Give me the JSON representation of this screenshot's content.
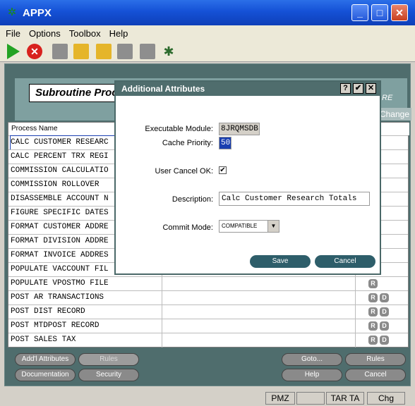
{
  "window": {
    "title": "APPX",
    "min": "_",
    "max": "□",
    "close": "✕"
  },
  "menu": [
    "File",
    "Options",
    "Toolbox",
    "Help"
  ],
  "header": {
    "subroutine_label": "Subroutine Proce",
    "logo_text": "RE",
    "change_tab": "Change"
  },
  "table": {
    "column_header": "Process Name",
    "rows": [
      {
        "name": "CALC CUSTOMER RESEARC",
        "badges": []
      },
      {
        "name": "CALC PERCENT TRX REGI",
        "badges": []
      },
      {
        "name": "COMMISSION CALCULATIO",
        "badges": []
      },
      {
        "name": "COMMISSION ROLLOVER",
        "badges": []
      },
      {
        "name": "DISASSEMBLE ACCOUNT N",
        "badges": []
      },
      {
        "name": "FIGURE SPECIFIC DATES",
        "badges": []
      },
      {
        "name": "FORMAT CUSTOMER ADDRE",
        "badges": []
      },
      {
        "name": "FORMAT DIVISION ADDRE",
        "badges": []
      },
      {
        "name": "FORMAT INVOICE ADDRES",
        "badges": []
      },
      {
        "name": "POPULATE VACCOUNT FIL",
        "badges": []
      },
      {
        "name": "POPULATE VPOSTMO FILE",
        "badges": [
          "R"
        ]
      },
      {
        "name": "POST AR TRANSACTIONS",
        "badges": [
          "R",
          "D"
        ]
      },
      {
        "name": "POST DIST RECORD",
        "badges": [
          "R",
          "D"
        ]
      },
      {
        "name": "POST MTDPOST RECORD",
        "badges": [
          "R",
          "D"
        ]
      },
      {
        "name": "POST SALES TAX",
        "badges": [
          "R",
          "D"
        ]
      }
    ]
  },
  "bottom_buttons": {
    "addl_attributes": "Add'l Attributes",
    "rules_left": "Rules",
    "documentation": "Documentation",
    "security": "Security",
    "goto": "Goto...",
    "rules_right": "Rules",
    "help": "Help",
    "cancel": "Cancel"
  },
  "dialog": {
    "title": "Additional Attributes",
    "help_btn": "?",
    "ok_btn": "✔",
    "close_btn": "✕",
    "exe_label": "Executable Module:",
    "exe_value": "8JRQMSDB",
    "prio_label": "Cache Priority:",
    "prio_value": "50",
    "cancel_ok_label": "User Cancel OK:",
    "cancel_ok_value": "✔",
    "desc_label": "Description:",
    "desc_value": "Calc Customer Research Totals",
    "commit_label": "Commit Mode:",
    "commit_value": "COMPATIBLE",
    "save": "Save",
    "cancel": "Cancel"
  },
  "status": [
    "PMZ",
    "TAR TA",
    "Chg"
  ]
}
